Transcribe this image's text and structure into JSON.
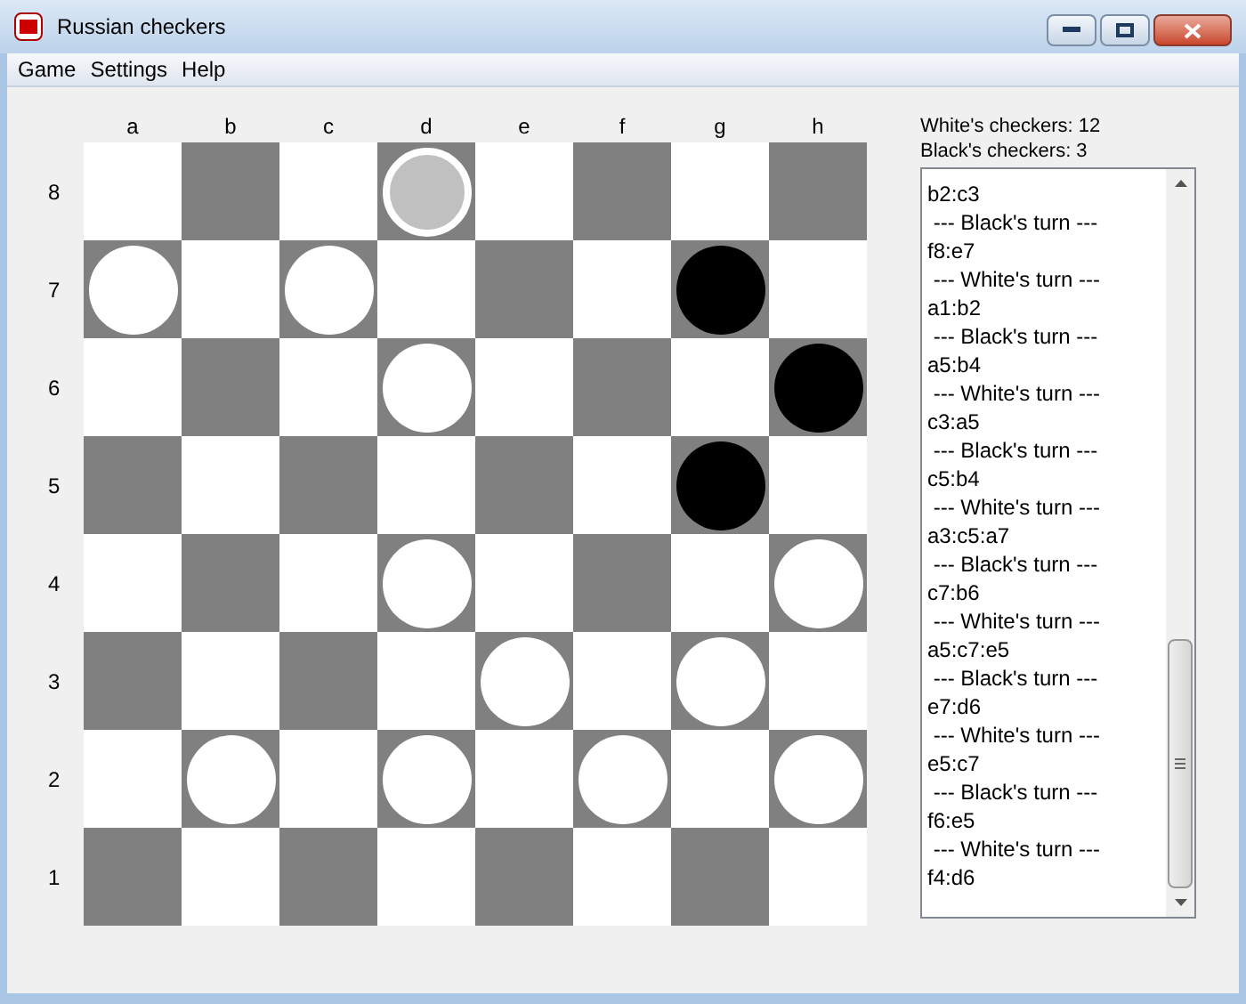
{
  "window": {
    "title": "Russian checkers"
  },
  "menu": [
    "Game",
    "Settings",
    "Help"
  ],
  "board": {
    "columns": [
      "a",
      "b",
      "c",
      "d",
      "e",
      "f",
      "g",
      "h"
    ],
    "rows": [
      {
        "label": "8",
        "cells": [
          {
            "kind": "empty",
            "selected": false
          },
          {
            "kind": "empty",
            "selected": false
          },
          {
            "kind": "empty",
            "selected": false
          },
          {
            "kind": "white",
            "selected": true
          },
          {
            "kind": "empty",
            "selected": false
          },
          {
            "kind": "empty",
            "selected": false
          },
          {
            "kind": "empty",
            "selected": false
          },
          {
            "kind": "empty",
            "selected": false
          }
        ]
      },
      {
        "label": "7",
        "cells": [
          {
            "kind": "white",
            "selected": false
          },
          {
            "kind": "empty",
            "selected": false
          },
          {
            "kind": "white",
            "selected": false
          },
          {
            "kind": "empty",
            "selected": false
          },
          {
            "kind": "empty",
            "selected": false
          },
          {
            "kind": "empty",
            "selected": false
          },
          {
            "kind": "black",
            "selected": false
          },
          {
            "kind": "empty",
            "selected": false
          }
        ]
      },
      {
        "label": "6",
        "cells": [
          {
            "kind": "empty",
            "selected": false
          },
          {
            "kind": "empty",
            "selected": false
          },
          {
            "kind": "empty",
            "selected": false
          },
          {
            "kind": "white",
            "selected": false
          },
          {
            "kind": "empty",
            "selected": false
          },
          {
            "kind": "empty",
            "selected": false
          },
          {
            "kind": "empty",
            "selected": false
          },
          {
            "kind": "black",
            "selected": false
          }
        ]
      },
      {
        "label": "5",
        "cells": [
          {
            "kind": "empty",
            "selected": false
          },
          {
            "kind": "empty",
            "selected": false
          },
          {
            "kind": "empty",
            "selected": false
          },
          {
            "kind": "empty",
            "selected": false
          },
          {
            "kind": "empty",
            "selected": false
          },
          {
            "kind": "empty",
            "selected": false
          },
          {
            "kind": "black",
            "selected": false
          },
          {
            "kind": "empty",
            "selected": false
          }
        ]
      },
      {
        "label": "4",
        "cells": [
          {
            "kind": "empty",
            "selected": false
          },
          {
            "kind": "empty",
            "selected": false
          },
          {
            "kind": "empty",
            "selected": false
          },
          {
            "kind": "white",
            "selected": false
          },
          {
            "kind": "empty",
            "selected": false
          },
          {
            "kind": "empty",
            "selected": false
          },
          {
            "kind": "empty",
            "selected": false
          },
          {
            "kind": "white",
            "selected": false
          }
        ]
      },
      {
        "label": "3",
        "cells": [
          {
            "kind": "empty",
            "selected": false
          },
          {
            "kind": "empty",
            "selected": false
          },
          {
            "kind": "empty",
            "selected": false
          },
          {
            "kind": "empty",
            "selected": false
          },
          {
            "kind": "white",
            "selected": false
          },
          {
            "kind": "empty",
            "selected": false
          },
          {
            "kind": "white",
            "selected": false
          },
          {
            "kind": "empty",
            "selected": false
          }
        ]
      },
      {
        "label": "2",
        "cells": [
          {
            "kind": "empty",
            "selected": false
          },
          {
            "kind": "white",
            "selected": false
          },
          {
            "kind": "empty",
            "selected": false
          },
          {
            "kind": "white",
            "selected": false
          },
          {
            "kind": "empty",
            "selected": false
          },
          {
            "kind": "white",
            "selected": false
          },
          {
            "kind": "empty",
            "selected": false
          },
          {
            "kind": "white",
            "selected": false
          }
        ]
      },
      {
        "label": "1",
        "cells": [
          {
            "kind": "empty",
            "selected": false
          },
          {
            "kind": "empty",
            "selected": false
          },
          {
            "kind": "empty",
            "selected": false
          },
          {
            "kind": "empty",
            "selected": false
          },
          {
            "kind": "empty",
            "selected": false
          },
          {
            "kind": "empty",
            "selected": false
          },
          {
            "kind": "empty",
            "selected": false
          },
          {
            "kind": "empty",
            "selected": false
          }
        ]
      }
    ]
  },
  "score": [
    "White's checkers: 12",
    "Black's checkers: 3"
  ],
  "log": [
    "b2:c3",
    " --- Black's turn ---",
    "f8:e7",
    " --- White's turn ---",
    "a1:b2",
    " --- Black's turn ---",
    "a5:b4",
    " --- White's turn ---",
    "c3:a5",
    " --- Black's turn ---",
    "c5:b4",
    " --- White's turn ---",
    "a3:c5:a7",
    " --- Black's turn ---",
    "c7:b6",
    " --- White's turn ---",
    "a5:c7:e5",
    " --- Black's turn ---",
    "e7:d6",
    " --- White's turn ---",
    "e5:c7",
    " --- Black's turn ---",
    "f6:e5",
    " --- White's turn ---",
    "f4:d6"
  ]
}
